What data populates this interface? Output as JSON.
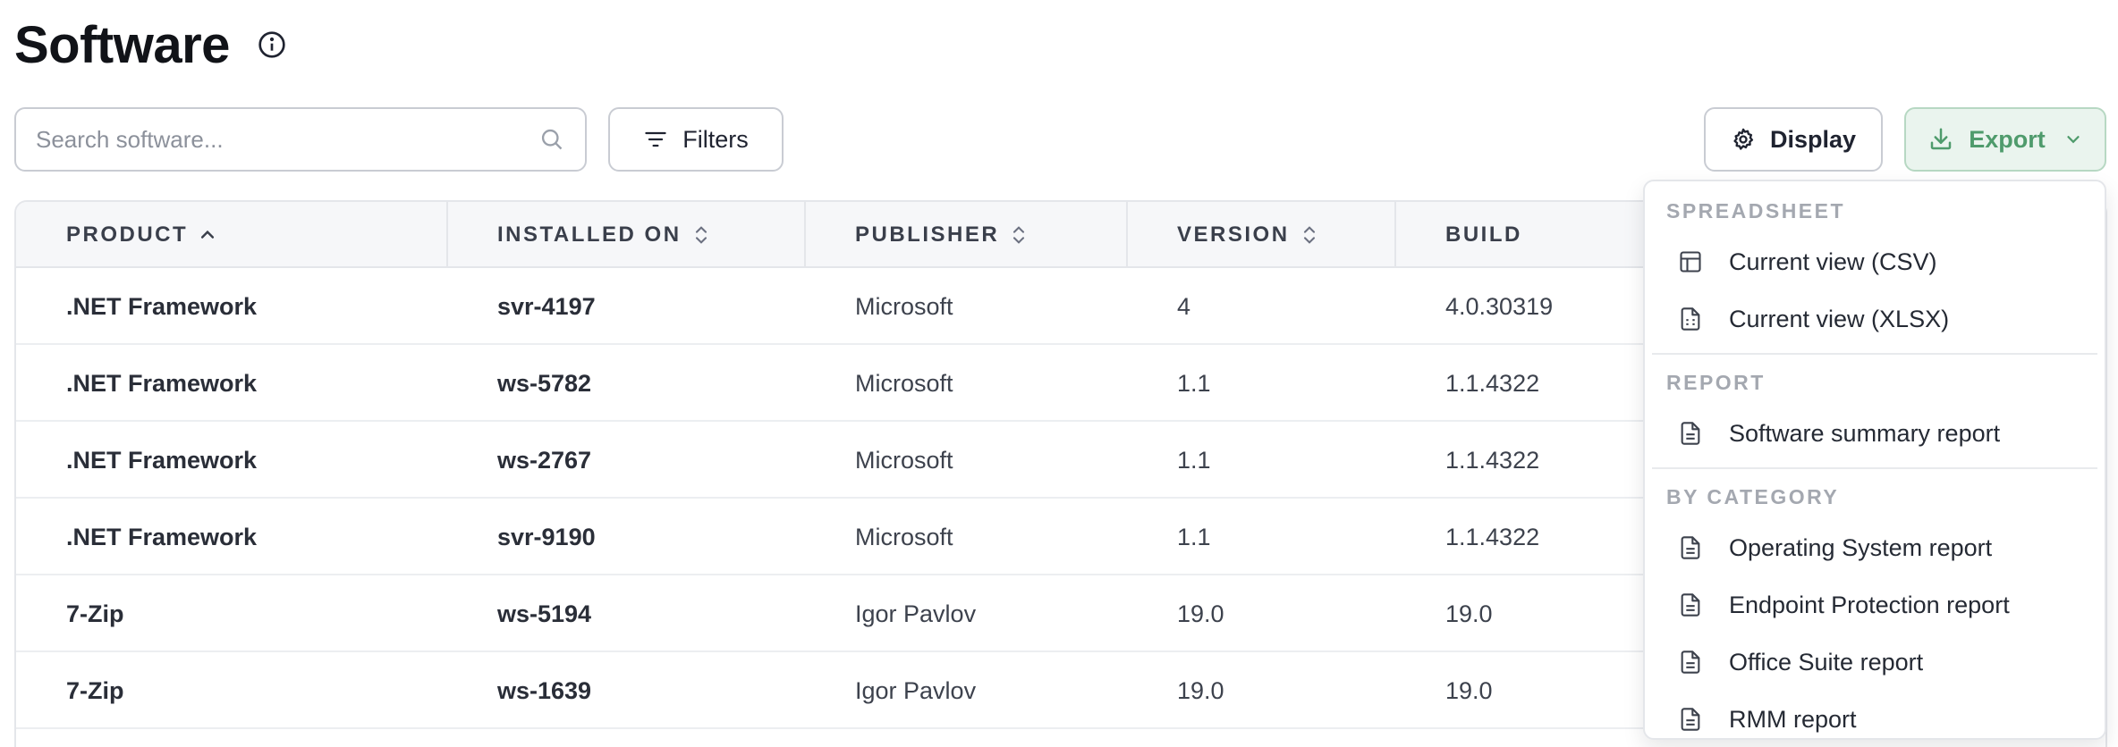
{
  "header": {
    "title": "Software"
  },
  "toolbar": {
    "search_placeholder": "Search software...",
    "search_value": "",
    "filters_label": "Filters",
    "display_label": "Display",
    "export_label": "Export",
    "export_color": "#4f9b6c"
  },
  "table": {
    "columns": [
      {
        "label": "PRODUCT",
        "sort": "ascending"
      },
      {
        "label": "INSTALLED ON",
        "sort": "none"
      },
      {
        "label": "PUBLISHER",
        "sort": "none"
      },
      {
        "label": "VERSION",
        "sort": "none"
      },
      {
        "label": "BUILD",
        "sort": "unsortable"
      }
    ],
    "rows": [
      {
        "product": ".NET Framework",
        "installed_on": "svr-4197",
        "publisher": "Microsoft",
        "version": "4",
        "build": "4.0.30319"
      },
      {
        "product": ".NET Framework",
        "installed_on": "ws-5782",
        "publisher": "Microsoft",
        "version": "1.1",
        "build": "1.1.4322"
      },
      {
        "product": ".NET Framework",
        "installed_on": "ws-2767",
        "publisher": "Microsoft",
        "version": "1.1",
        "build": "1.1.4322"
      },
      {
        "product": ".NET Framework",
        "installed_on": "svr-9190",
        "publisher": "Microsoft",
        "version": "1.1",
        "build": "1.1.4322"
      },
      {
        "product": "7-Zip",
        "installed_on": "ws-5194",
        "publisher": "Igor Pavlov",
        "version": "19.0",
        "build": "19.0"
      },
      {
        "product": "7-Zip",
        "installed_on": "ws-1639",
        "publisher": "Igor Pavlov",
        "version": "19.0",
        "build": "19.0"
      }
    ]
  },
  "export_menu": {
    "sections": [
      {
        "title": "SPREADSHEET",
        "items": [
          {
            "label": "Current view (CSV)",
            "icon": "table-icon"
          },
          {
            "label": "Current view (XLSX)",
            "icon": "spreadsheet-file-icon"
          }
        ]
      },
      {
        "title": "REPORT",
        "items": [
          {
            "label": "Software summary report",
            "icon": "document-icon"
          }
        ]
      },
      {
        "title": "BY CATEGORY",
        "items": [
          {
            "label": "Operating System report",
            "icon": "document-icon"
          },
          {
            "label": "Endpoint Protection report",
            "icon": "document-icon"
          },
          {
            "label": "Office Suite report",
            "icon": "document-icon"
          },
          {
            "label": "RMM report",
            "icon": "document-icon"
          }
        ]
      }
    ]
  }
}
